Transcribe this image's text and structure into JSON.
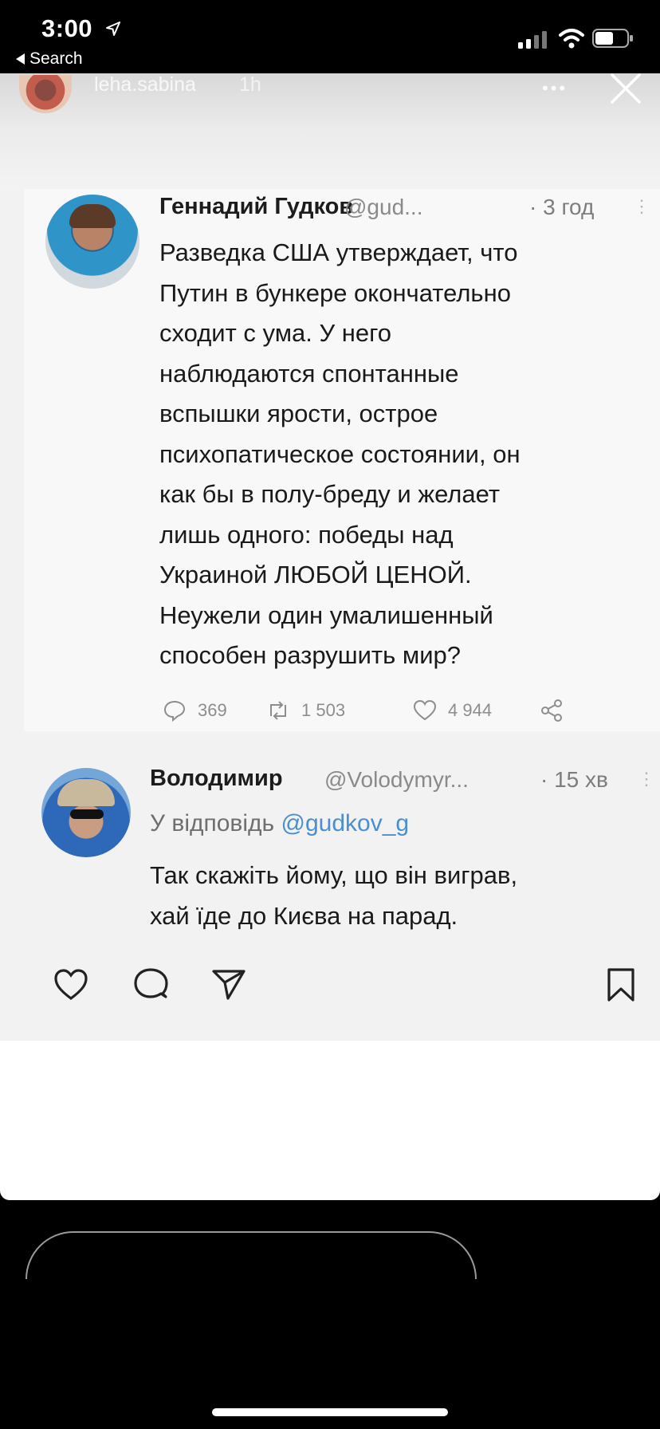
{
  "status_bar": {
    "time": "3:00",
    "back_label": "Search",
    "location_icon": "location-arrow-icon",
    "signal_icon": "cellular-signal-icon",
    "wifi_icon": "wifi-icon",
    "battery_icon": "battery-icon"
  },
  "post": {
    "username": "leha.sabina",
    "time": "1h",
    "more_label": "•••"
  },
  "tweet": {
    "name": "Геннадий Гудков",
    "handle": "@gud...",
    "time": "· 3 год",
    "lines": [
      "Разведка США утверждает, что",
      "Путин в бункере окончательно",
      "сходит с ума. У него",
      "наблюдаются спонтанные",
      "вспышки ярости, острое",
      "психопатическое состоянии, он",
      "как бы в полу-бреду и желает",
      "лишь одного: победы над",
      "Украиной ЛЮБОЙ ЦЕНОЙ.",
      "Неужели один умалишенный",
      "способен разрушить мир?"
    ],
    "replies": "369",
    "retweets": "1 503",
    "likes": "4 944"
  },
  "reply": {
    "name": "Володимир",
    "handle": "@Volodymyr...",
    "time": "· 15 хв",
    "reply_prefix": "У відповідь",
    "mention": "@gudkov_g",
    "lines": [
      "Так скажіть йому, що він виграв,",
      "хай їде до Києва на парад."
    ]
  },
  "colors": {
    "mention_blue": "#4a8fcf",
    "muted_gray": "#8a8a8a",
    "text_dark": "#1a1a1a"
  }
}
